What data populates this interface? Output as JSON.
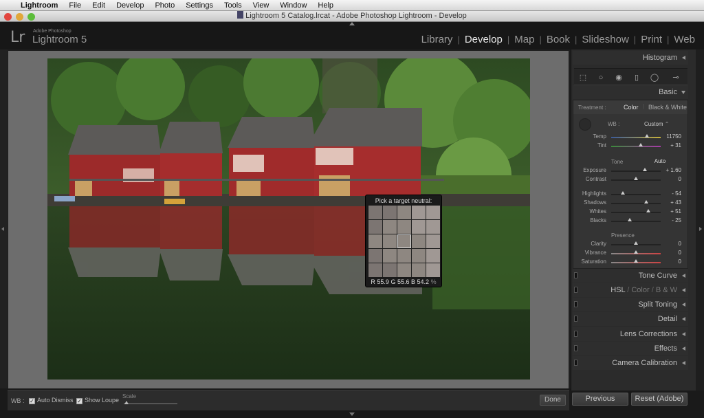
{
  "menubar": {
    "items": [
      "Lightroom",
      "File",
      "Edit",
      "Develop",
      "Photo",
      "Settings",
      "Tools",
      "View",
      "Window",
      "Help"
    ]
  },
  "window": {
    "title": "Lightroom 5 Catalog.lrcat - Adobe Photoshop Lightroom - Develop"
  },
  "header": {
    "logo": "Lr",
    "brand_small": "Adobe Photoshop",
    "brand_name": "Lightroom 5",
    "modules": [
      "Library",
      "Develop",
      "Map",
      "Book",
      "Slideshow",
      "Print",
      "Web"
    ],
    "active_module": "Develop"
  },
  "loupe": {
    "title": "Pick a target neutral:",
    "r_label": "R",
    "r_value": "55.9",
    "g_label": "G",
    "g_value": "55.6",
    "b_label": "B",
    "b_value": "54.2",
    "unit": "%"
  },
  "toolbar": {
    "wb_label": "WB :",
    "auto_dismiss": "Auto Dismiss",
    "show_loupe": "Show Loupe",
    "scale_label": "Scale",
    "done": "Done"
  },
  "panel": {
    "histogram": "Histogram",
    "basic": "Basic",
    "treatment_label": "Treatment :",
    "treatment_color": "Color",
    "treatment_bw": "Black & White",
    "wb_label": "WB :",
    "wb_value": "Custom",
    "tone_label": "Tone",
    "auto_label": "Auto",
    "presence_label": "Presence",
    "sliders": [
      {
        "label": "Temp",
        "value": "11750",
        "pos": 0.72
      },
      {
        "label": "Tint",
        "value": "+ 31",
        "pos": 0.6
      },
      {
        "label": "Exposure",
        "value": "+ 1.60",
        "pos": 0.68
      },
      {
        "label": "Contrast",
        "value": "0",
        "pos": 0.5
      },
      {
        "label": "Highlights",
        "value": "- 54",
        "pos": 0.23
      },
      {
        "label": "Shadows",
        "value": "+ 43",
        "pos": 0.71
      },
      {
        "label": "Whites",
        "value": "+ 51",
        "pos": 0.75
      },
      {
        "label": "Blacks",
        "value": "- 25",
        "pos": 0.38
      },
      {
        "label": "Clarity",
        "value": "0",
        "pos": 0.5
      },
      {
        "label": "Vibrance",
        "value": "0",
        "pos": 0.5
      },
      {
        "label": "Saturation",
        "value": "0",
        "pos": 0.5
      }
    ],
    "tone_curve": "Tone Curve",
    "hsl_parts": [
      "HSL",
      "Color",
      "B & W"
    ],
    "split_toning": "Split Toning",
    "detail": "Detail",
    "lens_corrections": "Lens Corrections",
    "effects": "Effects",
    "camera_calibration": "Camera Calibration",
    "previous": "Previous",
    "reset": "Reset (Adobe)"
  },
  "colors": {
    "panel_bg": "#2b2b2b",
    "canvas_bg": "#6d6d6d",
    "active_module": "#e8e8e8"
  }
}
